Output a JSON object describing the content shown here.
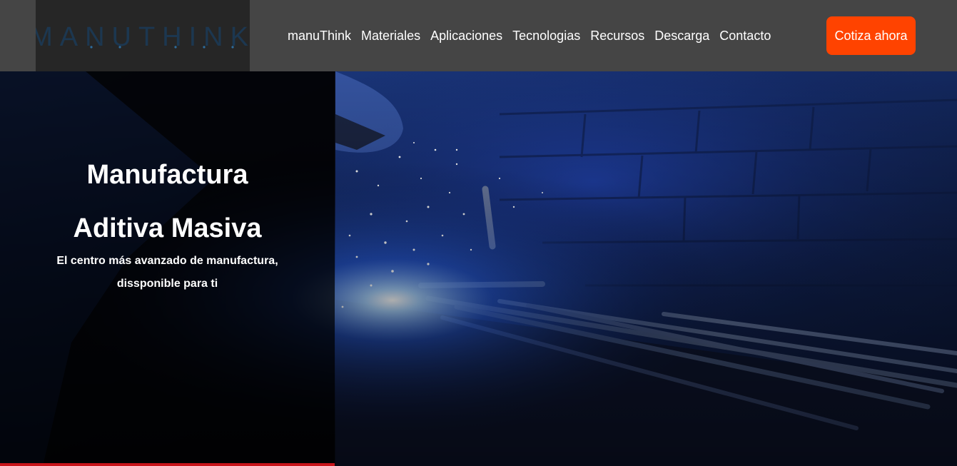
{
  "brand": {
    "logo_text": "MANUTHINK",
    "colors": {
      "header_bg": "#454545",
      "logo_bg": "#262626",
      "logo_text": "#1c3a55",
      "accent": "#ff4300",
      "hero_line": "#c8151b"
    }
  },
  "nav": {
    "items": [
      {
        "label": "manuThink"
      },
      {
        "label": "Materiales"
      },
      {
        "label": "Aplicaciones"
      },
      {
        "label": "Tecnologias"
      },
      {
        "label": "Recursos"
      },
      {
        "label": "Descarga"
      },
      {
        "label": "Contacto"
      }
    ],
    "cta_label": "Cotiza ahora"
  },
  "hero": {
    "title_line1": "Manufactura",
    "title_line2": "Aditiva Masiva",
    "subtitle_line1": "El centro más avanzado de manufactura,",
    "subtitle_line2": "dissponible para ti",
    "image": "welding-sparks-photo"
  }
}
